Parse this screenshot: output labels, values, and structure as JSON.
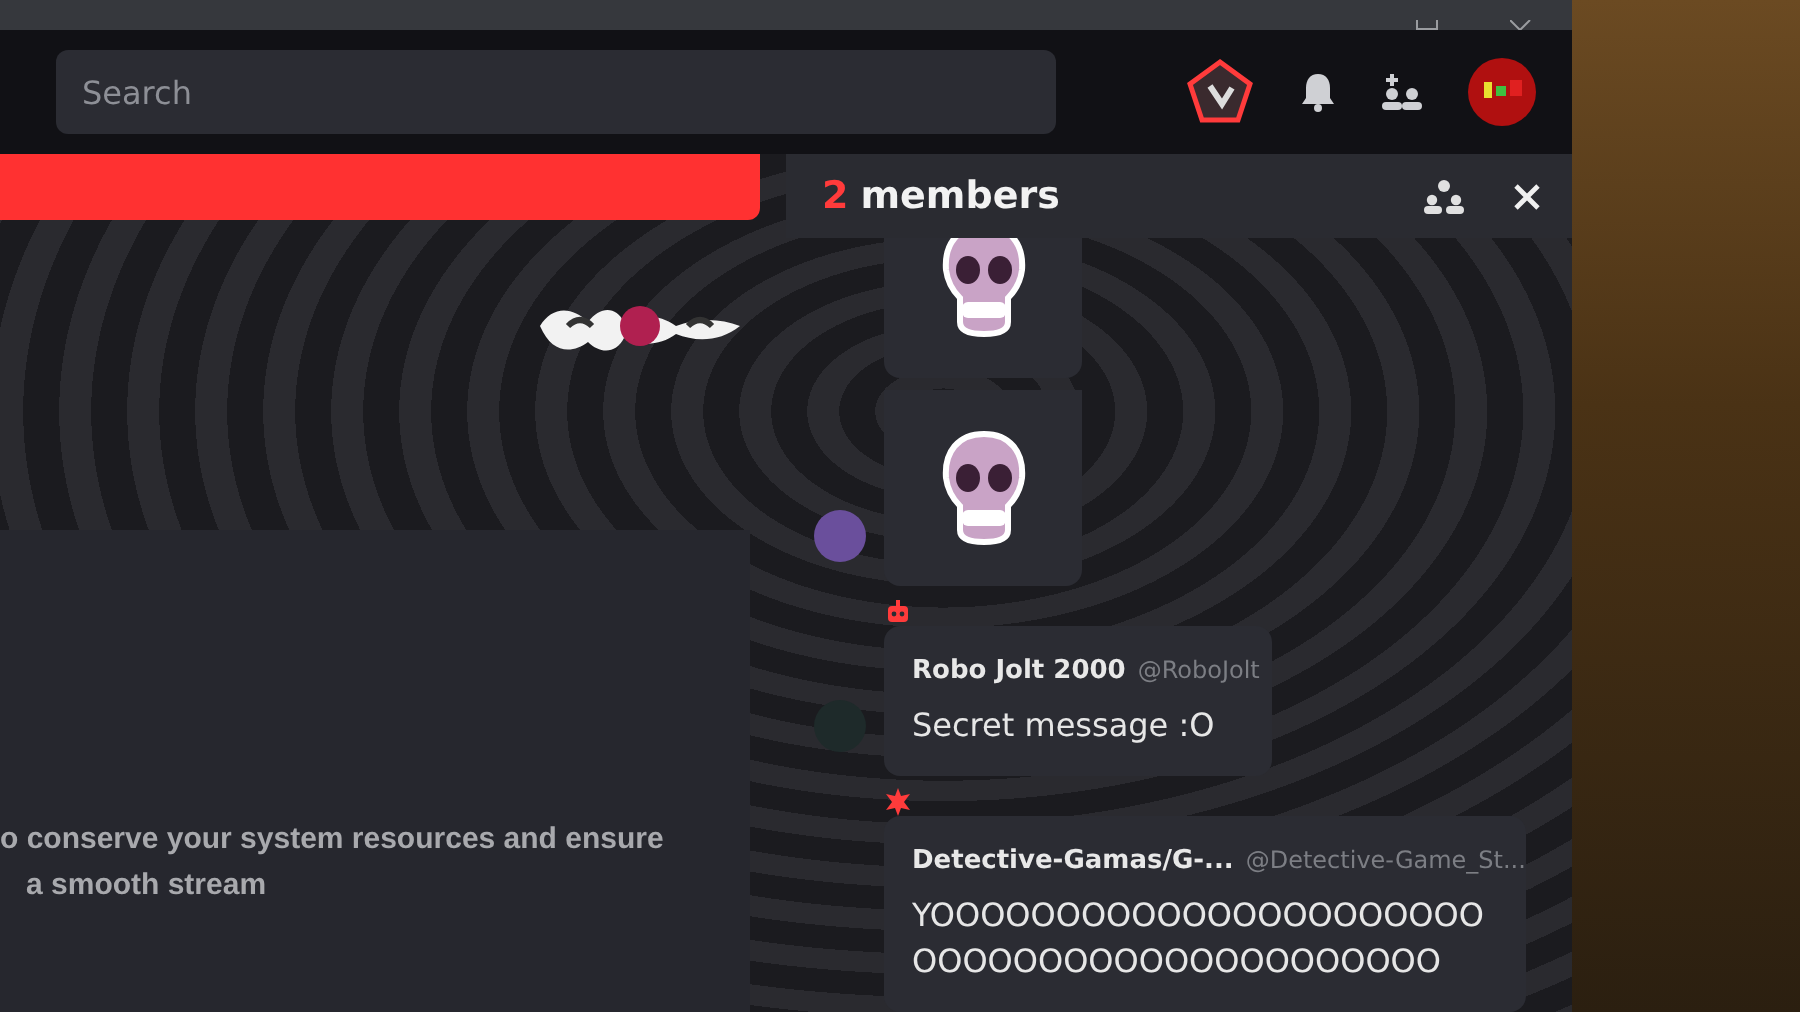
{
  "search": {
    "placeholder": "Search"
  },
  "members_panel": {
    "count": "2",
    "label": "members"
  },
  "stream_notice": {
    "lines": [
      "o conserve your system resources and ensure",
      "a smooth stream"
    ]
  },
  "messages": [
    {
      "kind": "sticker",
      "avatar": false
    },
    {
      "kind": "sticker",
      "avatar": true
    },
    {
      "kind": "text",
      "avatar": true,
      "role_badge": {
        "kind": "robot"
      },
      "author": "Robo Jolt 2000",
      "handle": "@RoboJolt",
      "body": "Secret message :O"
    },
    {
      "kind": "text",
      "avatar": false,
      "role_badge": {
        "kind": "burst"
      },
      "author": "Detective-Gamas/G-...",
      "handle": "@Detective-Game_St...",
      "body": "YOOOOOOOOOOOOOOOOOOOOOOOOOOOOOOOOOOOOOOOOOOO"
    }
  ]
}
